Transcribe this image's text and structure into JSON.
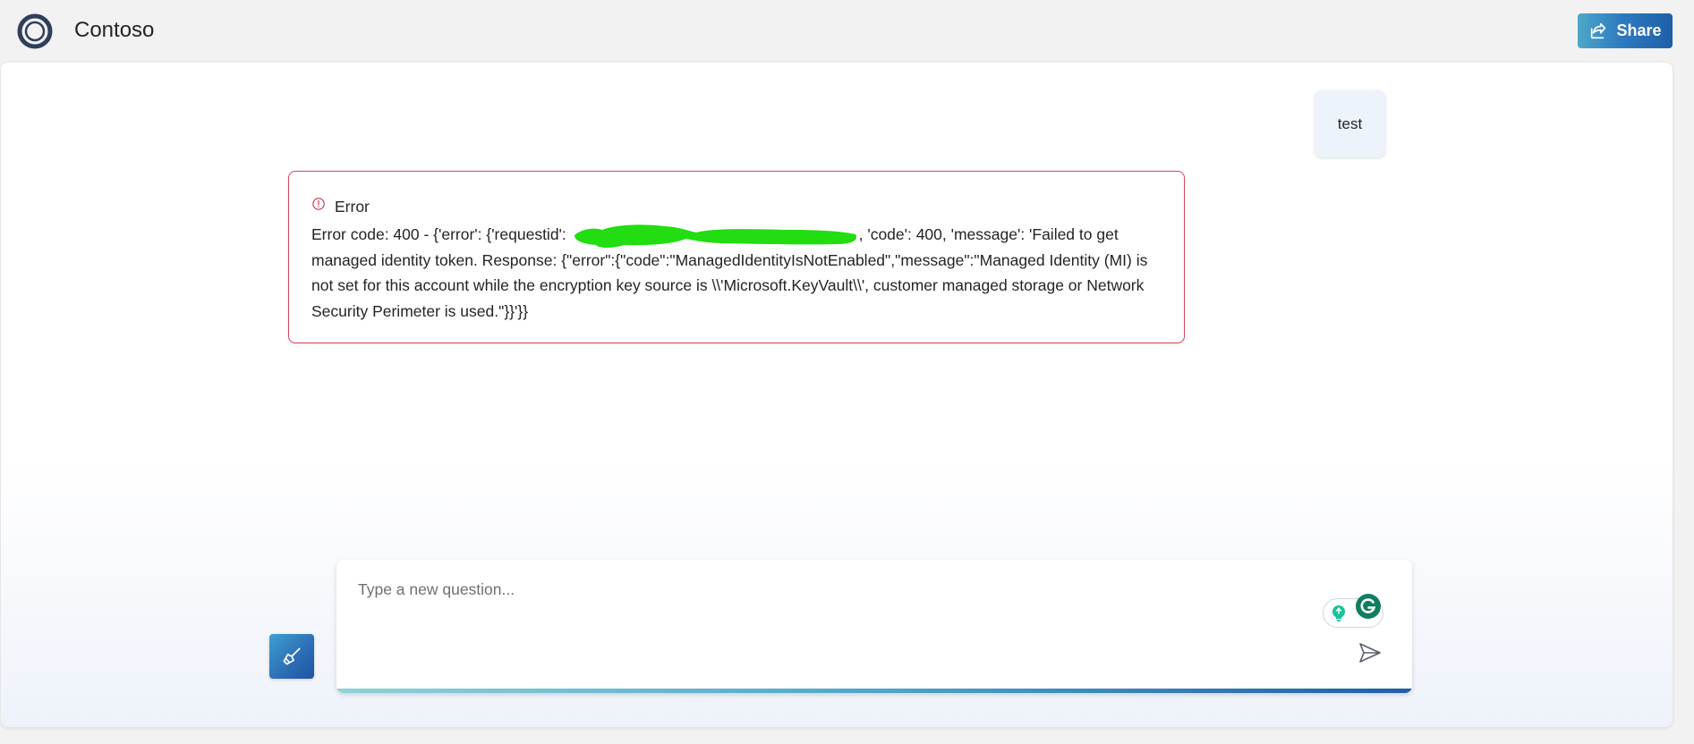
{
  "header": {
    "app_title": "Contoso",
    "logo_icon": "contoso-logo-icon",
    "share_label": "Share",
    "share_icon": "share-icon"
  },
  "chat": {
    "user_message": "test",
    "error": {
      "title": "Error",
      "icon": "error-circle-icon",
      "text_before_redaction": "Error code: 400 - {'error': {'requestid': ",
      "text_after_redaction": ", 'code': 400, 'message': 'Failed to get managed identity token. Response: {\"error\":{\"code\":\"ManagedIdentityIsNotEnabled\",\"message\":\"Managed Identity (MI) is not set for this account while the encryption key source is \\\\'Microsoft.KeyVault\\\\', customer managed storage or Network Security Perimeter is used.\"}}'}}",
      "redaction_color": "#22dd11"
    }
  },
  "composer": {
    "placeholder": "Type a new question...",
    "value": "",
    "clear_icon": "broom-icon",
    "send_icon": "send-icon",
    "grammarly_icons": [
      "lightbulb-icon",
      "grammarly-icon"
    ]
  },
  "colors": {
    "accent": "#2b6cb5",
    "error_border": "#d9485f",
    "user_bubble": "#edf3fb"
  }
}
